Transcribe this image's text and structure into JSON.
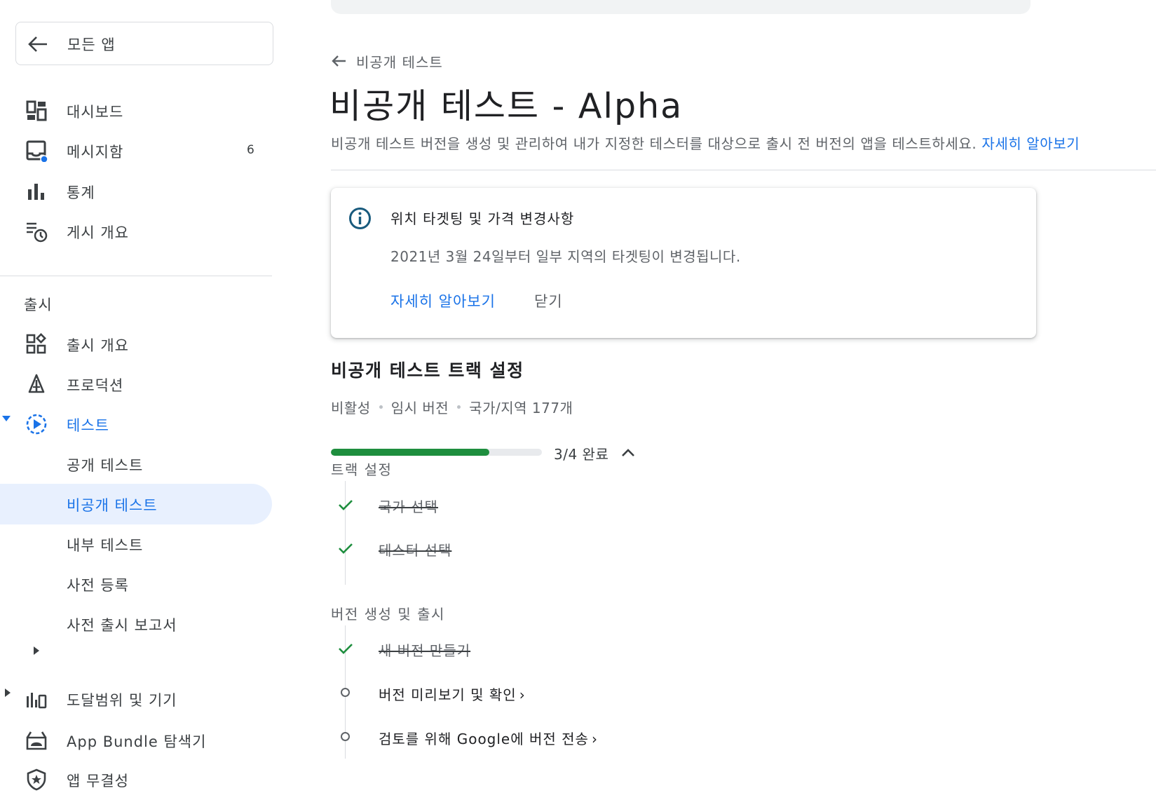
{
  "sidebar": {
    "back_label": "모든 앱",
    "items": [
      {
        "label": "대시보드"
      },
      {
        "label": "메시지함",
        "count": "6"
      },
      {
        "label": "통계"
      },
      {
        "label": "게시 개요"
      }
    ],
    "section_head": "출시",
    "release_items": [
      {
        "label": "출시 개요"
      },
      {
        "label": "프로덕션"
      },
      {
        "label": "테스트"
      }
    ],
    "test_sub_items": [
      {
        "label": "공개 테스트"
      },
      {
        "label": "비공개 테스트"
      },
      {
        "label": "내부 테스트"
      },
      {
        "label": "사전 등록"
      },
      {
        "label": "사전 출시 보고서"
      }
    ],
    "bottom_items": [
      {
        "label": "도달범위 및 기기"
      },
      {
        "label": "App Bundle 탐색기"
      },
      {
        "label": "앱 무결성"
      }
    ]
  },
  "main": {
    "breadcrumb": "비공개 테스트",
    "title": "비공개 테스트 - Alpha",
    "description": "비공개 테스트 버전을 생성 및 관리하여 내가 지정한 테스터를 대상으로 출시 전 버전의 앱을 테스트하세요.",
    "description_link": "자세히 알아보기",
    "notice": {
      "title": "위치 타겟팅 및 가격 변경사항",
      "body": "2021년 3월 24일부터 일부 지역의 타겟팅이 변경됩니다.",
      "learn_more": "자세히 알아보기",
      "dismiss": "닫기"
    },
    "track": {
      "title": "비공개 테스트 트랙 설정",
      "status": "비활성",
      "version": "임시 버전",
      "countries": "국가/지역 177개",
      "progress_fraction": 0.75,
      "progress_text": "3/4 완료"
    },
    "groups": [
      {
        "head": "트랙 설정",
        "steps": [
          {
            "label": "국가 선택",
            "done": true
          },
          {
            "label": "테스터 선택",
            "done": true
          }
        ]
      },
      {
        "head": "버전 생성 및 출시",
        "steps": [
          {
            "label": "새 버전 만들기",
            "done": true
          },
          {
            "label": "버전 미리보기 및 확인",
            "done": false
          },
          {
            "label": "검토를 위해 Google에 버전 전송",
            "done": false
          }
        ]
      }
    ]
  },
  "colors": {
    "accent": "#1a73e8",
    "selected_bg": "#e8f0fe",
    "progress": "#1e8e3e",
    "check": "#1e8e3e"
  }
}
